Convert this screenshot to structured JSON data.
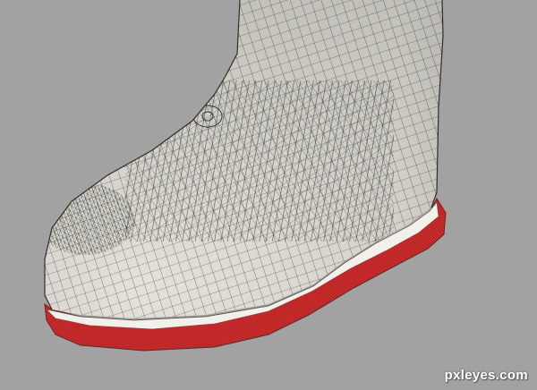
{
  "viewport": {
    "header_text": "",
    "watermark": "pxleyes.com",
    "colors": {
      "background": "#a2a2a2",
      "mesh_fill": "#ebe9e1",
      "wireframe": "#3a3a36",
      "sole": "#d63030",
      "midsole": "#f2f0ea"
    }
  },
  "object": {
    "name_icon": "boot-mesh"
  }
}
